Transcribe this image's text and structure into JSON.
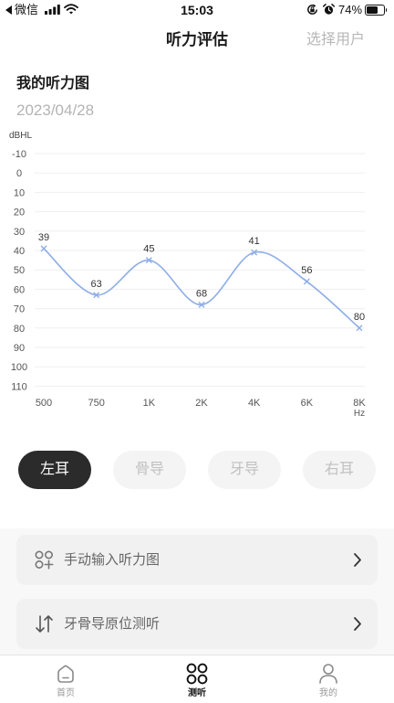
{
  "status_bar": {
    "back_label": "微信",
    "time": "15:03",
    "battery_percent": "74%",
    "battery_level": 0.74
  },
  "nav": {
    "title": "听力评估",
    "right_action": "选择用户"
  },
  "card": {
    "title": "我的听力图",
    "date": "2023/04/28"
  },
  "chart_data": {
    "type": "line",
    "ylabel": "dBHL",
    "x": [
      "500",
      "750",
      "1K",
      "2K",
      "4K",
      "6K",
      "8K"
    ],
    "x_unit": "Hz",
    "y_ticks": [
      -10,
      0,
      10,
      20,
      30,
      40,
      50,
      60,
      70,
      80,
      90,
      100,
      110
    ],
    "ylim": [
      -10,
      110
    ],
    "y_inverted": true,
    "smooth": true,
    "grid": true,
    "data_labels": true,
    "series": [
      {
        "values": [
          39,
          63,
          45,
          68,
          41,
          56,
          80
        ],
        "color": "#8eaee6"
      }
    ]
  },
  "ear_tabs": [
    {
      "label": "左耳",
      "selected": true
    },
    {
      "label": "骨导",
      "selected": false
    },
    {
      "label": "牙导",
      "selected": false
    },
    {
      "label": "右耳",
      "selected": false
    }
  ],
  "menu": [
    {
      "label": "手动输入听力图",
      "icon": "circles-plus-icon"
    },
    {
      "label": "牙骨导原位测听",
      "icon": "sort-arrows-icon"
    }
  ],
  "tab_bar": [
    {
      "label": "首页",
      "icon": "home-icon",
      "active": false
    },
    {
      "label": "测听",
      "icon": "four-circles-icon",
      "active": true
    },
    {
      "label": "我的",
      "icon": "user-icon",
      "active": false
    }
  ],
  "colors": {
    "accent_dark": "#2b2b2b",
    "curve": "#8eaee6",
    "inactive_text": "#9a9a9a"
  }
}
